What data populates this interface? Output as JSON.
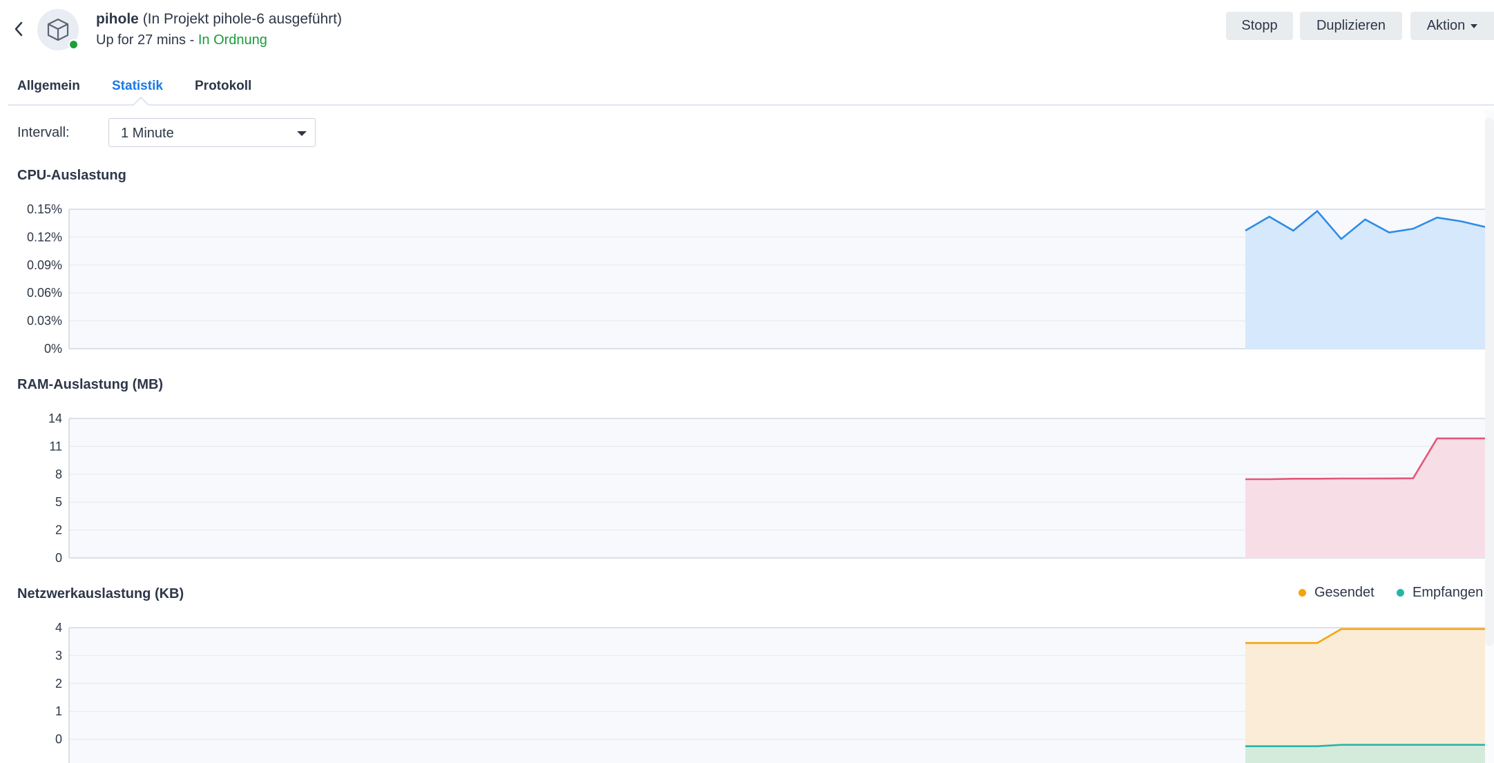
{
  "header": {
    "container_name": "pihole",
    "project_note": "(In Projekt pihole-6 ausgeführt)",
    "uptime": "Up for 27 mins -",
    "health": "In Ordnung",
    "buttons": {
      "stop": "Stopp",
      "duplicate": "Duplizieren",
      "action": "Aktion"
    }
  },
  "tabs": [
    {
      "label": "Allgemein",
      "active": false
    },
    {
      "label": "Statistik",
      "active": true
    },
    {
      "label": "Protokoll",
      "active": false
    }
  ],
  "interval": {
    "label": "Intervall:",
    "value": "1 Minute"
  },
  "sections": {
    "cpu": "CPU-Auslastung",
    "ram": "RAM-Auslastung (MB)",
    "network": "Netzwerkauslastung (KB)"
  },
  "legend": {
    "sent": "Gesendet",
    "received": "Empfangen"
  },
  "colors": {
    "accent": "#1a7ae6",
    "status_ok": "#179b3a",
    "cpu_line": "#2d8be8",
    "cpu_fill": "#d6e8fb",
    "ram_line": "#e25678",
    "ram_fill": "#f7dde6",
    "sent_line": "#f4a40a",
    "sent_fill": "#faecd6",
    "recv_line": "#25b5a7",
    "recv_fill": "#d4ebdc",
    "plot_bg": "#f7f9fc",
    "grid": "#e4e9ef"
  },
  "chart_data": [
    {
      "type": "area",
      "title": "CPU-Auslastung",
      "ytick_labels": [
        "0.15%",
        "0.12%",
        "0.09%",
        "0.06%",
        "0.03%",
        "0%"
      ],
      "ylim": [
        0,
        0.15
      ],
      "series": [
        {
          "values": [
            0.127,
            0.142,
            0.127,
            0.148,
            0.118,
            0.139,
            0.125,
            0.129,
            0.141,
            0.137,
            0.131
          ]
        }
      ]
    },
    {
      "type": "area",
      "title": "RAM-Auslastung (MB)",
      "ytick_labels": [
        "14",
        "11",
        "8",
        "5",
        "2",
        "0"
      ],
      "ylim": [
        0,
        14
      ],
      "series": [
        {
          "values": [
            7.9,
            7.9,
            7.95,
            7.95,
            7.97,
            7.97,
            7.98,
            7.99,
            12,
            12,
            12
          ]
        }
      ]
    },
    {
      "type": "area",
      "title": "Netzwerkauslastung (KB)",
      "ytick_labels": [
        "4",
        "3",
        "2",
        "1",
        "0"
      ],
      "ylim": [
        -1,
        4
      ],
      "legend": "top-right",
      "series": [
        {
          "name": "Gesendet",
          "values": [
            3.45,
            3.45,
            3.45,
            3.45,
            3.95,
            3.95,
            3.95,
            3.95,
            3.95,
            3.95,
            3.95
          ]
        },
        {
          "name": "Empfangen",
          "values": [
            -0.25,
            -0.25,
            -0.25,
            -0.25,
            -0.2,
            -0.2,
            -0.2,
            -0.2,
            -0.2,
            -0.2,
            -0.2
          ]
        }
      ]
    }
  ]
}
